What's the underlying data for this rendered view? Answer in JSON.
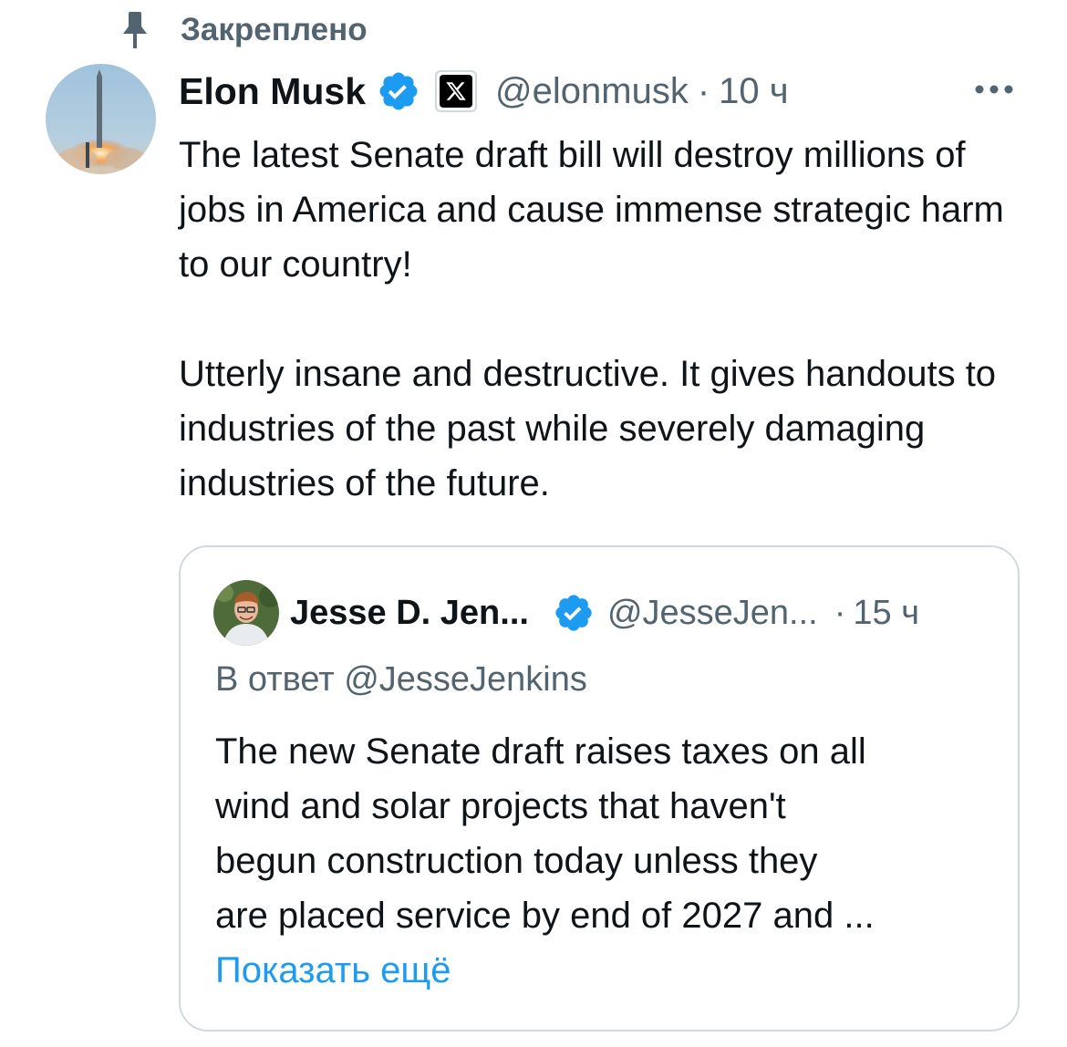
{
  "pinned": {
    "label": "Закреплено",
    "icon": "pin-icon"
  },
  "tweet": {
    "author_name": "Elon Musk",
    "verified_icon": "verified-badge-icon",
    "affiliate_icon": "x-logo-icon",
    "handle": "@elonmusk",
    "separator": "·",
    "time": "10 ч",
    "more_icon": "more-options-icon",
    "text_paragraph_1": "The latest Senate draft bill will destroy millions of jobs in America and cause immense strategic harm to our country!",
    "text_paragraph_2": "Utterly insane and destructive. It gives handouts to industries of the past while severely damaging industries of the future."
  },
  "quote": {
    "author_name": "Jesse D. Jen...",
    "verified_icon": "verified-badge-icon",
    "handle": "@JesseJen...",
    "separator": "·",
    "time": "15 ч",
    "reply_to": "В ответ @JesseJenkins",
    "text_lines": [
      "The new Senate draft raises taxes on all",
      "wind and solar projects that haven't",
      "begun construction today unless they",
      "are placed service by end of 2027 and ..."
    ],
    "show_more": "Показать ещё"
  },
  "colors": {
    "text_primary": "#0f1419",
    "text_secondary": "#536471",
    "accent": "#1d9bf0",
    "border": "#cfd9de"
  }
}
